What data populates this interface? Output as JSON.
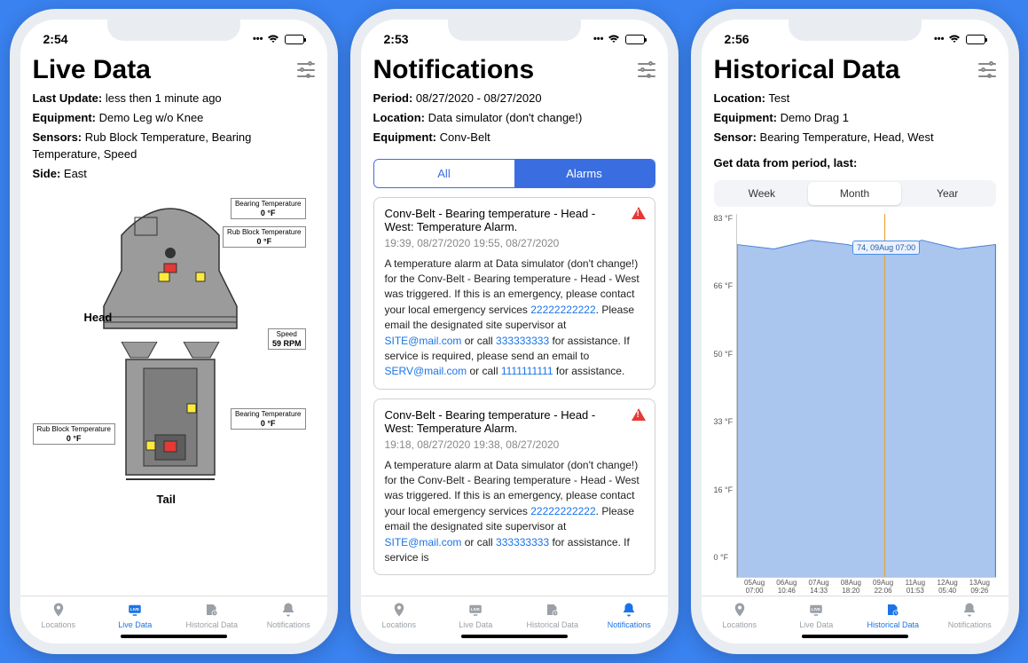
{
  "phones": [
    {
      "time": "2:54",
      "title": "Live Data",
      "meta": [
        {
          "label": "Last Update:",
          "value": "less then 1 minute ago"
        },
        {
          "label": "Equipment:",
          "value": "Demo Leg w/o Knee"
        },
        {
          "label": "Sensors:",
          "value": "Rub Block Temperature, Bearing Temperature, Speed"
        },
        {
          "label": "Side:",
          "value": "East"
        }
      ],
      "diagram": {
        "head_label": "Head",
        "tail_label": "Tail",
        "labels": [
          {
            "name": "Bearing Temperature",
            "val": "0 °F"
          },
          {
            "name": "Rub Block Temperature",
            "val": "0 °F"
          },
          {
            "name": "Speed",
            "val": "59 RPM"
          },
          {
            "name": "Bearing Temperature",
            "val": "0 °F"
          },
          {
            "name": "Rub Block Temperature",
            "val": "0 °F"
          }
        ]
      },
      "active_tab": 1
    },
    {
      "time": "2:53",
      "title": "Notifications",
      "meta": [
        {
          "label": "Period:",
          "value": "08/27/2020 - 08/27/2020"
        },
        {
          "label": "Location:",
          "value": "Data simulator (don't change!)"
        },
        {
          "label": "Equipment:",
          "value": "Conv-Belt"
        }
      ],
      "seg": {
        "all": "All",
        "alarms": "Alarms",
        "active": "alarms"
      },
      "cards": [
        {
          "title": "Conv-Belt - Bearing temperature - Head - West: Temperature Alarm.",
          "time": "19:39, 08/27/2020 19:55, 08/27/2020",
          "body_parts": [
            "A temperature alarm at Data simulator (don't change!) for the Conv-Belt - Bearing temperature - Head - West was triggered. If this is an emergency, please contact your local emergency services ",
            {
              "link": "22222222222"
            },
            ". Please email the designated site supervisor at ",
            {
              "link": "SITE@mail.com"
            },
            " or call ",
            {
              "link": "333333333"
            },
            " for assistance. If service is required, please send an email to ",
            {
              "link": "SERV@mail.com"
            },
            " or call ",
            {
              "link": "1111111111"
            },
            " for assistance."
          ]
        },
        {
          "title": "Conv-Belt - Bearing temperature - Head - West: Temperature Alarm.",
          "time": "19:18, 08/27/2020 19:38, 08/27/2020",
          "body_parts": [
            "A temperature alarm at Data simulator (don't change!) for the Conv-Belt - Bearing temperature - Head - West was triggered. If this is an emergency, please contact your local emergency services ",
            {
              "link": "22222222222"
            },
            ". Please email the designated site supervisor at ",
            {
              "link": "SITE@mail.com"
            },
            " or call ",
            {
              "link": "333333333"
            },
            " for assistance. If service is"
          ]
        }
      ],
      "active_tab": 3
    },
    {
      "time": "2:56",
      "title": "Historical Data",
      "meta": [
        {
          "label": "Location:",
          "value": "Test"
        },
        {
          "label": "Equipment:",
          "value": "Demo Drag 1"
        },
        {
          "label": "Sensor:",
          "value": "Bearing Temperature, Head, West"
        }
      ],
      "period_prompt": "Get data from period, last:",
      "periods": {
        "opts": [
          "Week",
          "Month",
          "Year"
        ],
        "active": "Month"
      },
      "chart_tooltip": "74, 09Aug 07:00",
      "active_tab": 2
    }
  ],
  "tabs": [
    "Locations",
    "Live Data",
    "Historical Data",
    "Notifications"
  ],
  "chart_data": {
    "type": "area",
    "title": "",
    "ylabel": "°F",
    "xlabel": "",
    "ylim": [
      0,
      83
    ],
    "y_ticks": [
      "83 °F",
      "66 °F",
      "50 °F",
      "33 °F",
      "16 °F",
      "0 °F"
    ],
    "x_ticks": [
      "05Aug 07:00",
      "06Aug 10:46",
      "07Aug 14:33",
      "08Aug 18:20",
      "09Aug 22:06",
      "11Aug 01:53",
      "12Aug 05:40",
      "13Aug 09:26"
    ],
    "series": [
      {
        "name": "Bearing Temperature",
        "x": [
          "05Aug",
          "06Aug",
          "07Aug",
          "08Aug",
          "09Aug",
          "11Aug",
          "12Aug",
          "13Aug"
        ],
        "values": [
          76,
          75,
          77,
          76,
          74,
          77,
          75,
          76
        ]
      }
    ],
    "tooltip_point": {
      "x": "09Aug 07:00",
      "y": 74
    }
  }
}
